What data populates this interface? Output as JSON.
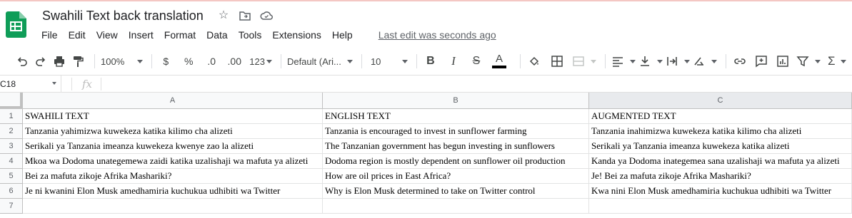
{
  "app": {
    "doc_title": "Swahili Text back translation",
    "brand_color": "#0f9d58"
  },
  "menu": {
    "items": [
      "File",
      "Edit",
      "View",
      "Insert",
      "Format",
      "Data",
      "Tools",
      "Extensions",
      "Help"
    ],
    "last_edit": "Last edit was seconds ago"
  },
  "toolbar": {
    "zoom": "100%",
    "currency": "$",
    "percent": "%",
    "decrease_decimal": ".0",
    "increase_decimal": ".00",
    "more_formats": "123",
    "font": "Default (Ari...",
    "font_size": "10"
  },
  "formula_bar": {
    "name_box": "C18",
    "fx": "fx",
    "value": ""
  },
  "sheet": {
    "columns": [
      "A",
      "B",
      "C"
    ],
    "selected_column": "C",
    "row_numbers": [
      "1",
      "2",
      "3",
      "4",
      "5",
      "6",
      "7"
    ],
    "rows": [
      [
        "SWAHILI TEXT",
        "ENGLISH TEXT",
        "AUGMENTED TEXT"
      ],
      [
        "Tanzania yahimizwa kuwekeza katika kilimo cha alizeti",
        "Tanzania is encouraged to invest in sunflower farming",
        "Tanzania inahimizwa kuwekeza katika kilimo cha alizeti"
      ],
      [
        "Serikali ya Tanzania imeanza kuwekeza kwenye zao la alizeti",
        "The Tanzanian government has begun investing in sunflowers",
        "Serikali ya Tanzania imeanza kuwekeza katika alizeti"
      ],
      [
        "Mkoa wa Dodoma unategemewa zaidi katika uzalishaji wa mafuta ya alizeti",
        "Dodoma region is mostly dependent on sunflower oil production",
        "Kanda ya Dodoma inategemea sana uzalishaji wa mafuta ya alizeti"
      ],
      [
        "Bei za mafuta zikoje Afrika Mashariki?",
        "How are oil prices in East Africa?",
        "Je! Bei za mafuta zikoje Afrika Mashariki?"
      ],
      [
        "Je ni kwanini Elon Musk amedhamiria kuchukua udhibiti wa Twitter",
        "Why is Elon Musk determined to take on Twitter control",
        "Kwa nini Elon Musk amedhamiria kuchukua udhibiti wa Twitter"
      ],
      [
        "",
        "",
        ""
      ]
    ]
  }
}
